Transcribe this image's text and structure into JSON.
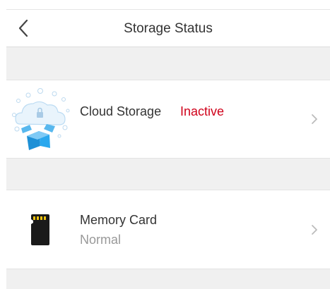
{
  "header": {
    "title": "Storage Status",
    "back_icon": "chevron-left-icon"
  },
  "rows": [
    {
      "label": "Cloud Storage",
      "status": "Inactive",
      "status_color": "#d0021b",
      "icon": "cloud-storage-icon",
      "chevron_icon": "chevron-right-icon"
    },
    {
      "label": "Memory Card",
      "status": "Normal",
      "status_color": "#999999",
      "icon": "memory-card-icon",
      "chevron_icon": "chevron-right-icon"
    }
  ],
  "colors": {
    "background": "#ffffff",
    "separator_band": "#f0f0f0",
    "text_primary": "#333333",
    "accent_blue": "#2a9fe0"
  }
}
